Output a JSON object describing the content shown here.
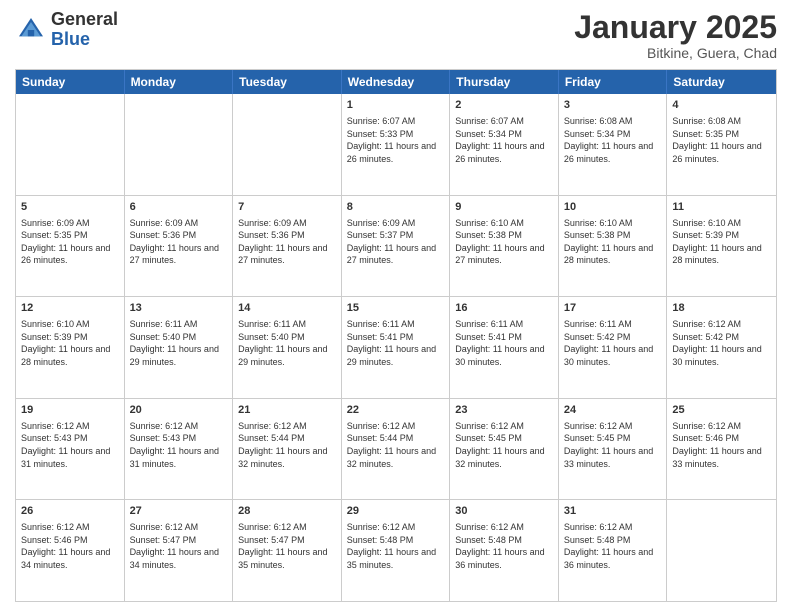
{
  "header": {
    "logo_general": "General",
    "logo_blue": "Blue",
    "month_title": "January 2025",
    "subtitle": "Bitkine, Guera, Chad"
  },
  "calendar": {
    "weekdays": [
      "Sunday",
      "Monday",
      "Tuesday",
      "Wednesday",
      "Thursday",
      "Friday",
      "Saturday"
    ],
    "rows": [
      [
        {
          "day": "",
          "sunrise": "",
          "sunset": "",
          "daylight": ""
        },
        {
          "day": "",
          "sunrise": "",
          "sunset": "",
          "daylight": ""
        },
        {
          "day": "",
          "sunrise": "",
          "sunset": "",
          "daylight": ""
        },
        {
          "day": "1",
          "sunrise": "Sunrise: 6:07 AM",
          "sunset": "Sunset: 5:33 PM",
          "daylight": "Daylight: 11 hours and 26 minutes."
        },
        {
          "day": "2",
          "sunrise": "Sunrise: 6:07 AM",
          "sunset": "Sunset: 5:34 PM",
          "daylight": "Daylight: 11 hours and 26 minutes."
        },
        {
          "day": "3",
          "sunrise": "Sunrise: 6:08 AM",
          "sunset": "Sunset: 5:34 PM",
          "daylight": "Daylight: 11 hours and 26 minutes."
        },
        {
          "day": "4",
          "sunrise": "Sunrise: 6:08 AM",
          "sunset": "Sunset: 5:35 PM",
          "daylight": "Daylight: 11 hours and 26 minutes."
        }
      ],
      [
        {
          "day": "5",
          "sunrise": "Sunrise: 6:09 AM",
          "sunset": "Sunset: 5:35 PM",
          "daylight": "Daylight: 11 hours and 26 minutes."
        },
        {
          "day": "6",
          "sunrise": "Sunrise: 6:09 AM",
          "sunset": "Sunset: 5:36 PM",
          "daylight": "Daylight: 11 hours and 27 minutes."
        },
        {
          "day": "7",
          "sunrise": "Sunrise: 6:09 AM",
          "sunset": "Sunset: 5:36 PM",
          "daylight": "Daylight: 11 hours and 27 minutes."
        },
        {
          "day": "8",
          "sunrise": "Sunrise: 6:09 AM",
          "sunset": "Sunset: 5:37 PM",
          "daylight": "Daylight: 11 hours and 27 minutes."
        },
        {
          "day": "9",
          "sunrise": "Sunrise: 6:10 AM",
          "sunset": "Sunset: 5:38 PM",
          "daylight": "Daylight: 11 hours and 27 minutes."
        },
        {
          "day": "10",
          "sunrise": "Sunrise: 6:10 AM",
          "sunset": "Sunset: 5:38 PM",
          "daylight": "Daylight: 11 hours and 28 minutes."
        },
        {
          "day": "11",
          "sunrise": "Sunrise: 6:10 AM",
          "sunset": "Sunset: 5:39 PM",
          "daylight": "Daylight: 11 hours and 28 minutes."
        }
      ],
      [
        {
          "day": "12",
          "sunrise": "Sunrise: 6:10 AM",
          "sunset": "Sunset: 5:39 PM",
          "daylight": "Daylight: 11 hours and 28 minutes."
        },
        {
          "day": "13",
          "sunrise": "Sunrise: 6:11 AM",
          "sunset": "Sunset: 5:40 PM",
          "daylight": "Daylight: 11 hours and 29 minutes."
        },
        {
          "day": "14",
          "sunrise": "Sunrise: 6:11 AM",
          "sunset": "Sunset: 5:40 PM",
          "daylight": "Daylight: 11 hours and 29 minutes."
        },
        {
          "day": "15",
          "sunrise": "Sunrise: 6:11 AM",
          "sunset": "Sunset: 5:41 PM",
          "daylight": "Daylight: 11 hours and 29 minutes."
        },
        {
          "day": "16",
          "sunrise": "Sunrise: 6:11 AM",
          "sunset": "Sunset: 5:41 PM",
          "daylight": "Daylight: 11 hours and 30 minutes."
        },
        {
          "day": "17",
          "sunrise": "Sunrise: 6:11 AM",
          "sunset": "Sunset: 5:42 PM",
          "daylight": "Daylight: 11 hours and 30 minutes."
        },
        {
          "day": "18",
          "sunrise": "Sunrise: 6:12 AM",
          "sunset": "Sunset: 5:42 PM",
          "daylight": "Daylight: 11 hours and 30 minutes."
        }
      ],
      [
        {
          "day": "19",
          "sunrise": "Sunrise: 6:12 AM",
          "sunset": "Sunset: 5:43 PM",
          "daylight": "Daylight: 11 hours and 31 minutes."
        },
        {
          "day": "20",
          "sunrise": "Sunrise: 6:12 AM",
          "sunset": "Sunset: 5:43 PM",
          "daylight": "Daylight: 11 hours and 31 minutes."
        },
        {
          "day": "21",
          "sunrise": "Sunrise: 6:12 AM",
          "sunset": "Sunset: 5:44 PM",
          "daylight": "Daylight: 11 hours and 32 minutes."
        },
        {
          "day": "22",
          "sunrise": "Sunrise: 6:12 AM",
          "sunset": "Sunset: 5:44 PM",
          "daylight": "Daylight: 11 hours and 32 minutes."
        },
        {
          "day": "23",
          "sunrise": "Sunrise: 6:12 AM",
          "sunset": "Sunset: 5:45 PM",
          "daylight": "Daylight: 11 hours and 32 minutes."
        },
        {
          "day": "24",
          "sunrise": "Sunrise: 6:12 AM",
          "sunset": "Sunset: 5:45 PM",
          "daylight": "Daylight: 11 hours and 33 minutes."
        },
        {
          "day": "25",
          "sunrise": "Sunrise: 6:12 AM",
          "sunset": "Sunset: 5:46 PM",
          "daylight": "Daylight: 11 hours and 33 minutes."
        }
      ],
      [
        {
          "day": "26",
          "sunrise": "Sunrise: 6:12 AM",
          "sunset": "Sunset: 5:46 PM",
          "daylight": "Daylight: 11 hours and 34 minutes."
        },
        {
          "day": "27",
          "sunrise": "Sunrise: 6:12 AM",
          "sunset": "Sunset: 5:47 PM",
          "daylight": "Daylight: 11 hours and 34 minutes."
        },
        {
          "day": "28",
          "sunrise": "Sunrise: 6:12 AM",
          "sunset": "Sunset: 5:47 PM",
          "daylight": "Daylight: 11 hours and 35 minutes."
        },
        {
          "day": "29",
          "sunrise": "Sunrise: 6:12 AM",
          "sunset": "Sunset: 5:48 PM",
          "daylight": "Daylight: 11 hours and 35 minutes."
        },
        {
          "day": "30",
          "sunrise": "Sunrise: 6:12 AM",
          "sunset": "Sunset: 5:48 PM",
          "daylight": "Daylight: 11 hours and 36 minutes."
        },
        {
          "day": "31",
          "sunrise": "Sunrise: 6:12 AM",
          "sunset": "Sunset: 5:48 PM",
          "daylight": "Daylight: 11 hours and 36 minutes."
        },
        {
          "day": "",
          "sunrise": "",
          "sunset": "",
          "daylight": ""
        }
      ]
    ]
  }
}
